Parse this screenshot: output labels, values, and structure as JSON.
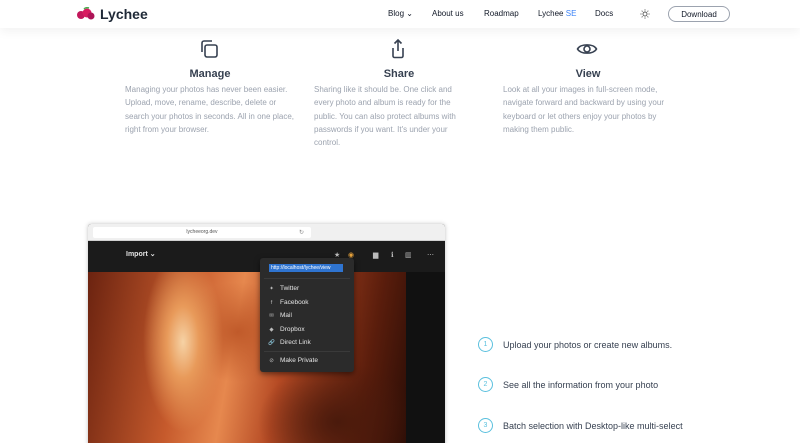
{
  "nav": {
    "logo_text": "Lychee",
    "items": [
      {
        "label": "Blog ⌄"
      },
      {
        "label": "About us"
      },
      {
        "label": "Roadmap"
      },
      {
        "label_main": "Lychee ",
        "label_accent": "SE"
      },
      {
        "label": "Docs"
      }
    ],
    "theme_icon": "sun-icon",
    "download_label": "Download"
  },
  "features": [
    {
      "icon": "copy-icon",
      "title": "Manage",
      "text": "Managing your photos has never been easier. Upload, move, rename, describe, delete or search your photos in seconds. All in one place, right from your browser."
    },
    {
      "icon": "share-icon",
      "title": "Share",
      "text": "Sharing like it should be. One click and every photo and album is ready for the public. You can also protect albums with passwords if you want. It's under your control."
    },
    {
      "icon": "eye-icon",
      "title": "View",
      "text": "Look at all your images in full-screen mode, navigate forward and backward by using your keyboard or let others enjoy your photos by making them public."
    }
  ],
  "mockup": {
    "url": "lycheeorg.dev",
    "import_label": "Import ⌄",
    "share_url": "http://localhost/lychee/view",
    "share_items": [
      {
        "icon": "twitter-icon",
        "glyph": "✦",
        "label": "Twitter"
      },
      {
        "icon": "facebook-icon",
        "glyph": "f",
        "label": "Facebook"
      },
      {
        "icon": "mail-icon",
        "glyph": "✉",
        "label": "Mail"
      },
      {
        "icon": "dropbox-icon",
        "glyph": "◆",
        "label": "Dropbox"
      },
      {
        "icon": "link-icon",
        "glyph": "🔗",
        "label": "Direct Link"
      },
      {
        "icon": "private-icon",
        "glyph": "⊘",
        "label": "Make Private"
      }
    ]
  },
  "steps": [
    {
      "num": "1",
      "text": "Upload your photos or create new albums."
    },
    {
      "num": "2",
      "text": "See all the information from your photo"
    },
    {
      "num": "3",
      "text": "Batch selection with Desktop-like multi-select"
    }
  ]
}
